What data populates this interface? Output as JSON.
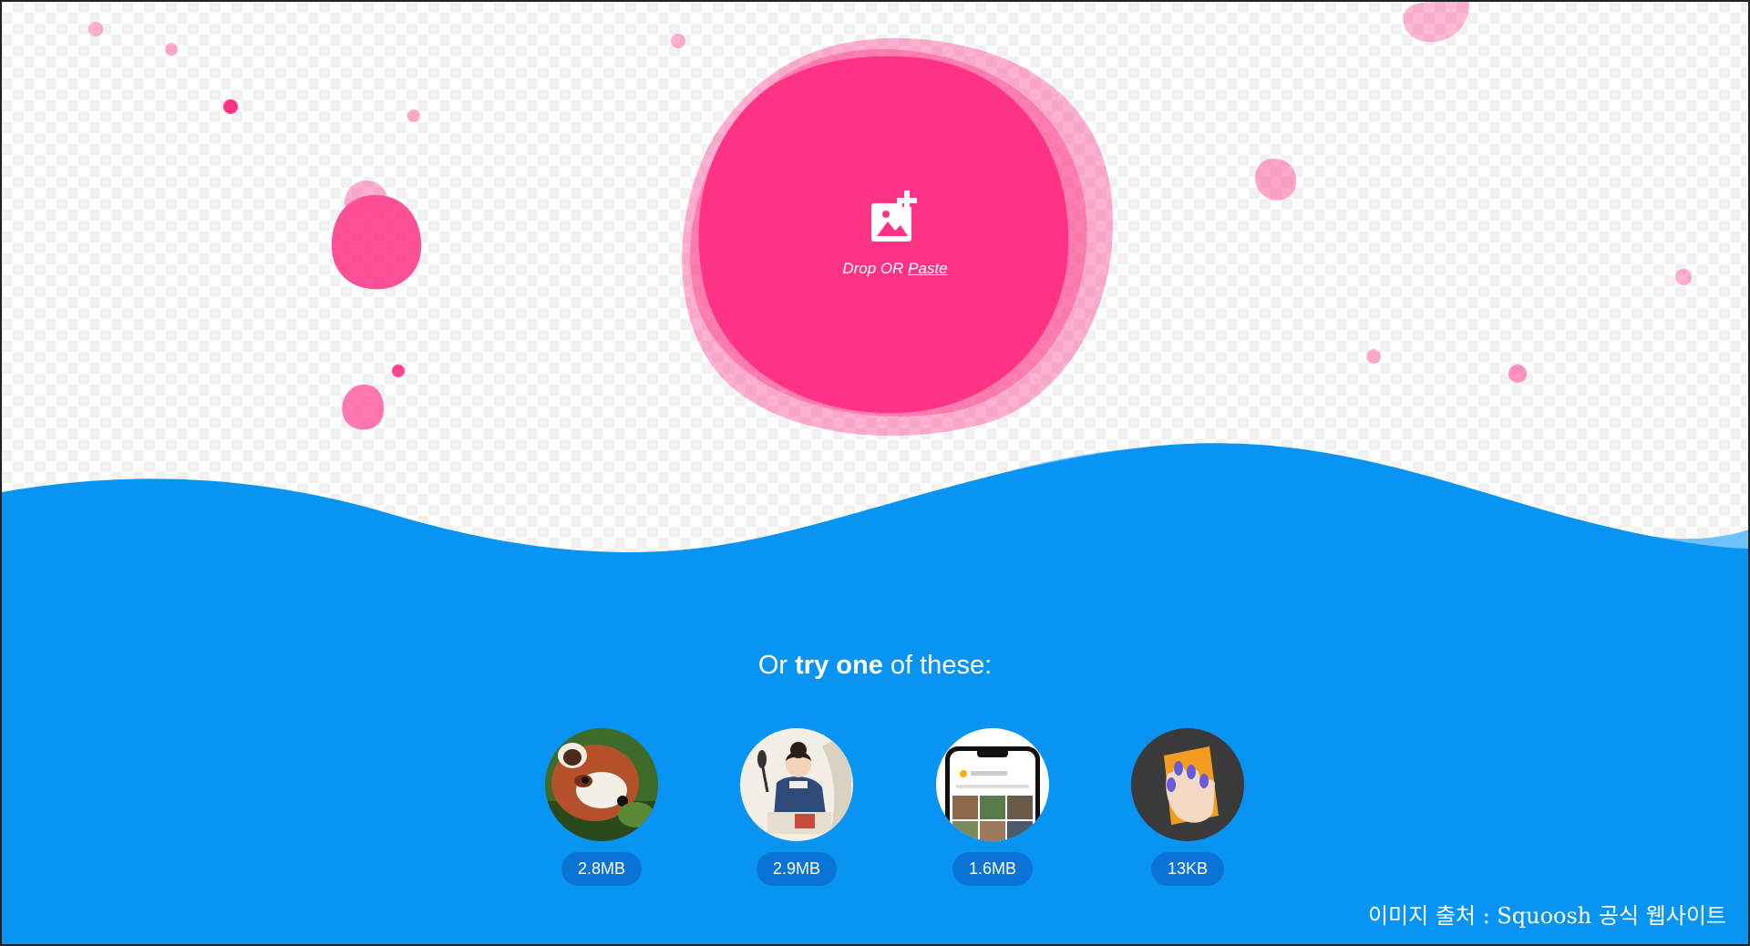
{
  "dropzone": {
    "icon": "add-image-icon",
    "drop_label": "Drop OR ",
    "paste_label": "Paste"
  },
  "try_section": {
    "heading_prefix": "Or ",
    "heading_bold": "try one",
    "heading_suffix": " of these:"
  },
  "demos": [
    {
      "size": "2.8MB",
      "icon": "red-panda-photo"
    },
    {
      "size": "2.9MB",
      "icon": "woman-illustration"
    },
    {
      "size": "1.6MB",
      "icon": "phone-screenshot"
    },
    {
      "size": "13KB",
      "icon": "hand-with-card-illustration"
    }
  ],
  "credit": "이미지 출처 : Squoosh 공식 웹사이트",
  "colors": {
    "blob_pink": "#ff3385",
    "wave_blue": "#0894f2",
    "badge_blue": "#0a74d6"
  }
}
